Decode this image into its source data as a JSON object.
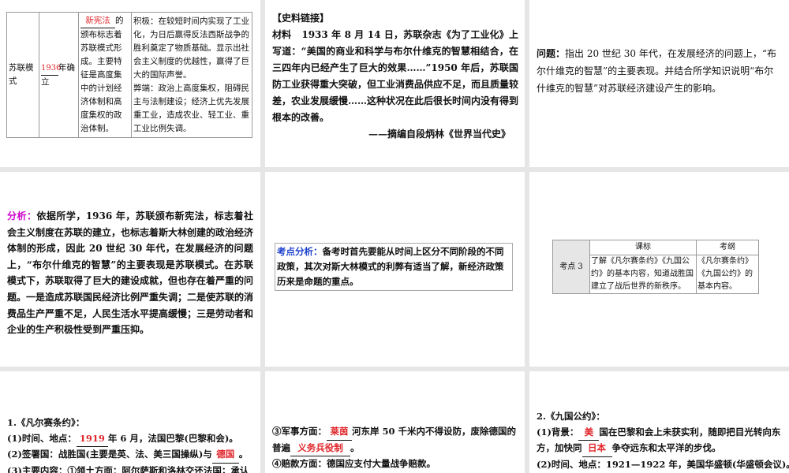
{
  "slide1": {
    "col1": "苏联模式",
    "col2_fill": "1936",
    "col2_rest": "年确立",
    "col3_fill": "新宪法",
    "col3_rest": "的颁布标志着苏联模式形成。主要特征是高度集中的计划经济体制和高度集权的政治体制。",
    "col4_pos": "积极：在较短时间内实现了工业化，为日后赢得反法西斯战争的胜利奠定了物质基础。显示出社会主义制度的优越性，赢得了巨大的国际声誉。",
    "col4_neg": "弊端：政治上高度集权，阻碍民主与法制建设；经济上优先发展重工业，造成农业、轻工业、重工业比例失调。"
  },
  "slide2": {
    "heading": "【史料链接】",
    "label": "材料",
    "body": "1933 年 8 月 14 日，苏联杂志《为了工业化》上写道：“美国的商业和科学与布尔什维克的智慧相结合，在三四年内已经产生了巨大的效果……”1950 年后，苏联国防工业获得重大突破，但工业消费品供应不足，而且质量较差，农业发展缓慢……这种状况在此后很长时间内没有得到根本的改善。",
    "source": "——摘编自段炳林《世界当代史》"
  },
  "slide3": {
    "label": "问题：",
    "body": "指出 20 世纪 30 年代，在发展经济的问题上，“布尔什维克的智慧”的主要表现。并结合所学知识说明“布尔什维克的智慧”对苏联经济建设产生的影响。"
  },
  "slide4": {
    "label": "分析：",
    "body": "依据所学，1936 年，苏联颁布新宪法，标志着社会主义制度在苏联的建立，也标志着斯大林创建的政治经济体制的形成，因此 20 世纪 30 年代，在发展经济的问题上，“布尔什维克的智慧”的主要表现是苏联模式。在苏联模式下，苏联取得了巨大的建设成就，但也存在着严重的问题。一是造成苏联国民经济比例严重失调；二是使苏联的消费品生产严重不足，人民生活水平提高缓慢；三是劳动者和企业的生产积极性受到严重压抑。"
  },
  "slide5": {
    "label": "考点分析：",
    "body": "备考时首先要能从时间上区分不同阶段的不同政策，其次对斯大林模式的利弊有适当了解，新经济政策历来是命题的重点。"
  },
  "slide6": {
    "header_standard": "课标",
    "header_outline": "考纲",
    "row_label": "考点 3",
    "standard": "了解《凡尔赛条约》《九国公约》的基本内容，知道战胜国建立了战后世界的新秩序。",
    "outline": "《凡尔赛条约》《九国公约》的基本内容。"
  },
  "slide7": {
    "title": "1.《凡尔赛条约》：",
    "l1_a": "(1)时间、地点：",
    "l1_fill": "1919",
    "l1_b": "年 6 月，法国巴黎(巴黎和会)。",
    "l2_a": "(2)签署国：战胜国(主要是英、法、美三国操纵)与",
    "l2_fill": "德国",
    "l2_b": "。",
    "l3": "(3)主要内容：①领土方面：阿尔萨斯和洛林交还法国；承认"
  },
  "slide8": {
    "l1_a": "③军事方面：",
    "l1_fill": "莱茵",
    "l1_b": "河东岸 50 千米内不得设防，废除德国的普遍",
    "l1_fill2": "义务兵役制",
    "l1_c": "。",
    "l2": "④赔款方面：德国应支付大量战争赔款。"
  },
  "slide9": {
    "title": "2.《九国公约》：",
    "l1_a": "(1)背景：",
    "l1_fill": "美",
    "l1_b": "国在巴黎和会上未获实利，随即把目光转向东方，加快同",
    "l1_fill2": "日本",
    "l1_c": "争夺远东和太平洋的步伐。",
    "l2": "(2)时间、地点：1921—1922 年，美国华盛顿(华盛顿会议)。"
  }
}
